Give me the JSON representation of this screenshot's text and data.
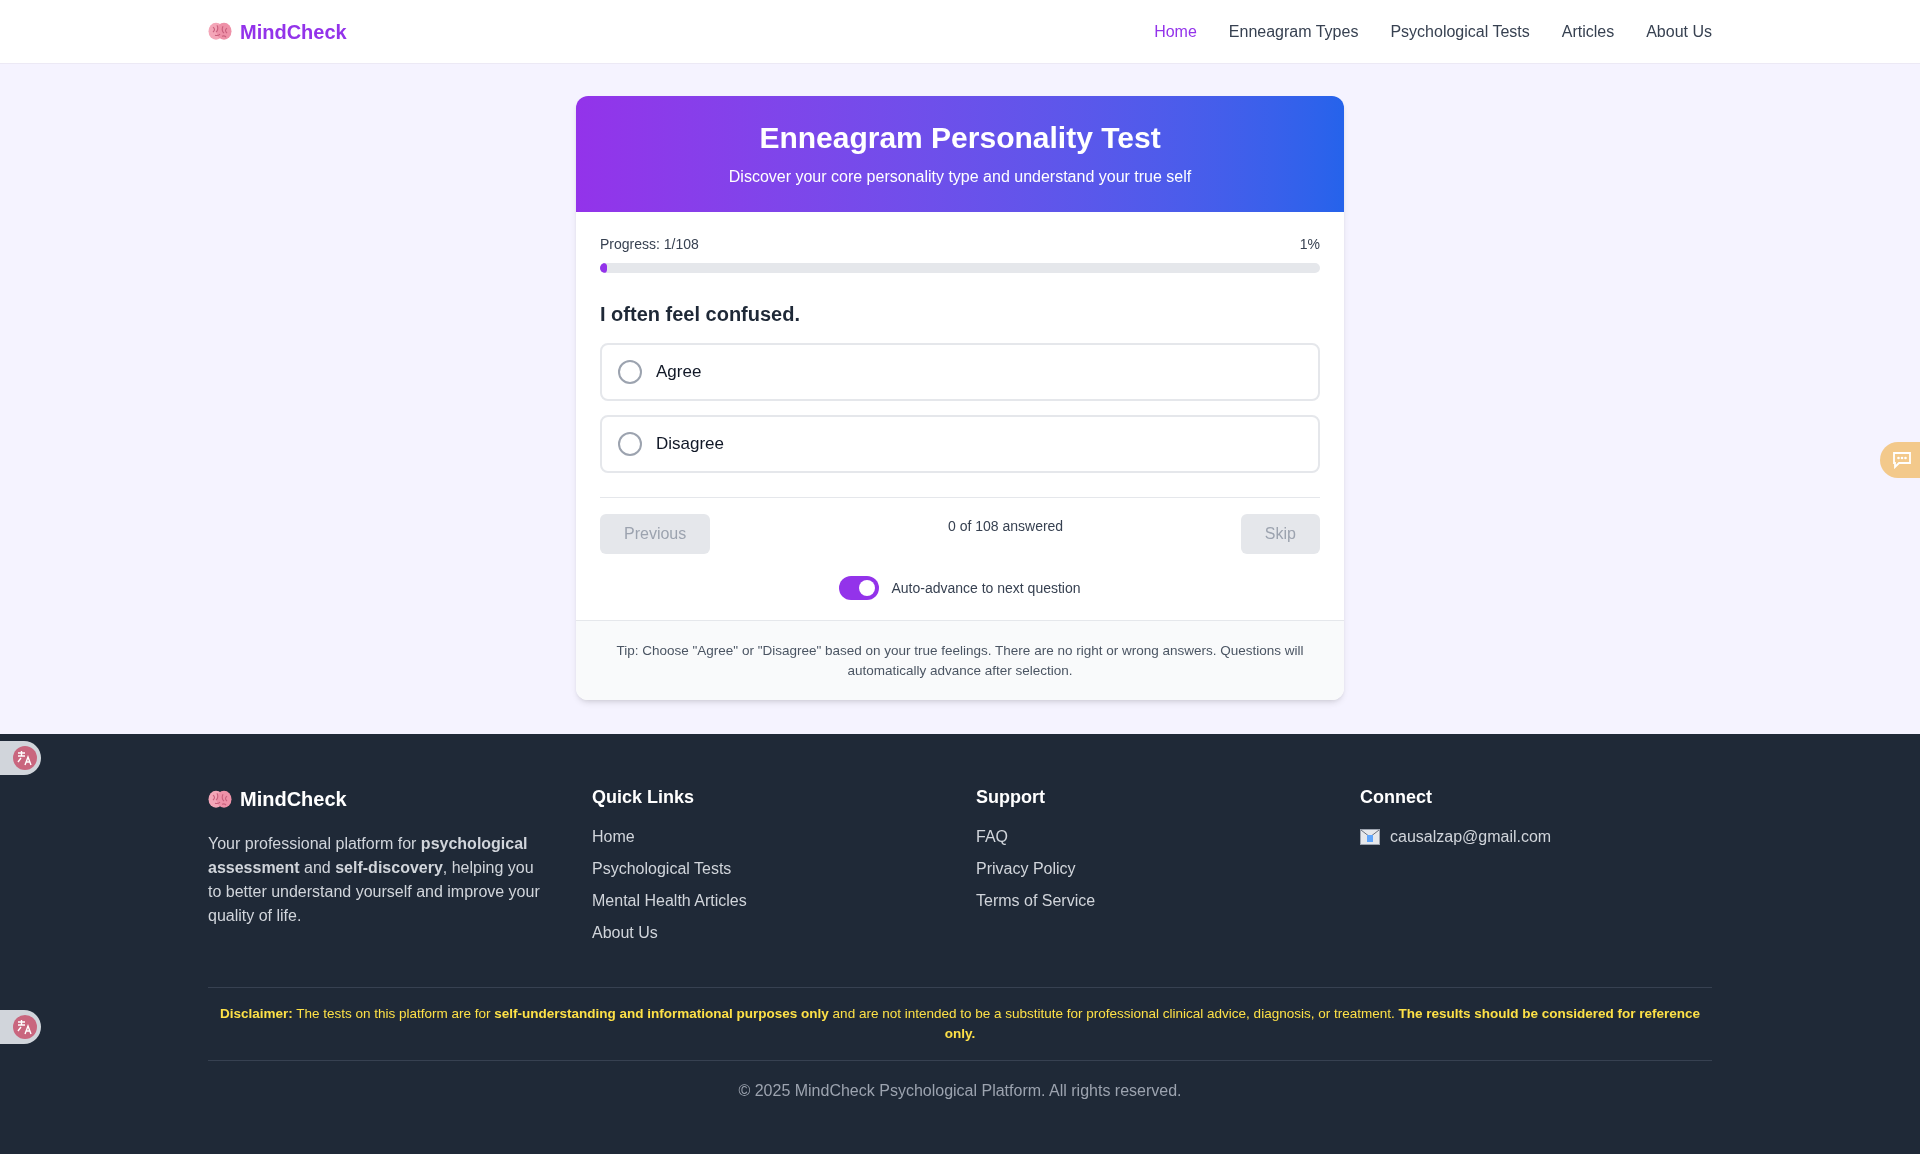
{
  "nav": {
    "brand": "MindCheck",
    "links": [
      {
        "label": "Home",
        "selected": true
      },
      {
        "label": "Enneagram Types",
        "selected": false
      },
      {
        "label": "Psychological Tests",
        "selected": false
      },
      {
        "label": "Articles",
        "selected": false
      },
      {
        "label": "About Us",
        "selected": false
      }
    ]
  },
  "card": {
    "title": "Enneagram Personality Test",
    "subtitle": "Discover your core personality type and understand your true self",
    "progress": {
      "label": "Progress: 1/108",
      "percent": "1%",
      "level": 0.01
    },
    "question": "I often feel confused.",
    "options": [
      {
        "label": "Agree",
        "selected": false
      },
      {
        "label": "Disagree",
        "selected": false
      }
    ],
    "previous": {
      "label": "Previous",
      "disabled": true
    },
    "answered": "0 of 108 answered",
    "skip": {
      "label": "Skip",
      "disabled": true
    },
    "auto_advance": {
      "label": "Auto-advance to next question",
      "on": true
    },
    "tip": "Tip: Choose \"Agree\" or \"Disagree\" based on your true feelings. There are no right or wrong answers. Questions will automatically advance after selection."
  },
  "footer": {
    "brand": "MindCheck",
    "about": "Your professional platform for **psychological assessment** and **self-discovery**, helping you to better understand yourself and improve your quality of life.",
    "columns": [
      {
        "heading": "Quick Links",
        "links": [
          "Home",
          "Psychological Tests",
          "Mental Health Articles",
          "About Us"
        ]
      },
      {
        "heading": "Support",
        "links": [
          "FAQ",
          "Privacy Policy",
          "Terms of Service"
        ]
      }
    ],
    "connect": {
      "heading": "Connect",
      "email": "causalzap@gmail.com"
    },
    "disclaimer": "**Disclaimer:** The tests on this platform are for **self-understanding and informational purposes only** and are not intended to be a substitute for professional clinical advice, diagnosis, or treatment. **The results should be considered for reference only.**",
    "copyright": "© 2025 MindCheck Psychological Platform. All rights reserved."
  }
}
